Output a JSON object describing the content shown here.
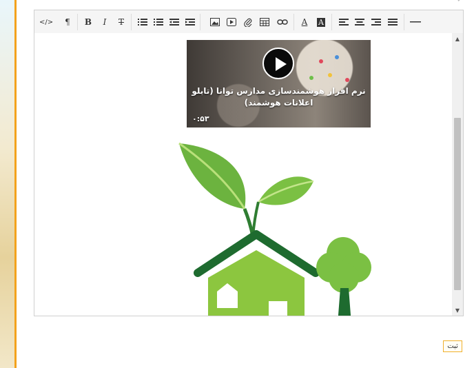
{
  "toolbar": {
    "buttons": [
      {
        "name": "source-code",
        "glyph": "</>"
      },
      {
        "name": "paragraph",
        "glyph": "¶"
      },
      {
        "name": "bold",
        "glyph": "B"
      },
      {
        "name": "italic",
        "glyph": "I"
      },
      {
        "name": "strikethrough",
        "glyph": "T"
      },
      {
        "name": "unordered-list",
        "icon": "bulleted-list-icon"
      },
      {
        "name": "ordered-list",
        "icon": "numbered-list-icon"
      },
      {
        "name": "outdent",
        "icon": "outdent-icon"
      },
      {
        "name": "indent",
        "icon": "indent-icon"
      },
      {
        "name": "insert-image",
        "icon": "image-icon"
      },
      {
        "name": "insert-video",
        "icon": "video-icon"
      },
      {
        "name": "attach-file",
        "icon": "paperclip-icon"
      },
      {
        "name": "insert-table",
        "icon": "table-icon"
      },
      {
        "name": "insert-link",
        "icon": "link-icon"
      },
      {
        "name": "font-color",
        "glyph": "A"
      },
      {
        "name": "background-color",
        "glyph": "A"
      },
      {
        "name": "align-left",
        "icon": "align-left-icon"
      },
      {
        "name": "align-center",
        "icon": "align-center-icon"
      },
      {
        "name": "align-right",
        "icon": "align-right-icon"
      },
      {
        "name": "justify",
        "icon": "justify-icon"
      },
      {
        "name": "horizontal-rule",
        "icon": "horizontal-rule-icon"
      }
    ]
  },
  "video": {
    "title": "نرم افزار هوشمندسازی مدارس توانا (تابلو اعلانات هوشمند)",
    "duration": "۰:۵۳"
  },
  "submit": {
    "label": "ثبت"
  },
  "colors": {
    "accent": "#f3a21c",
    "logo_light_green": "#8cc63f",
    "logo_dark_green": "#1e6b2f"
  }
}
